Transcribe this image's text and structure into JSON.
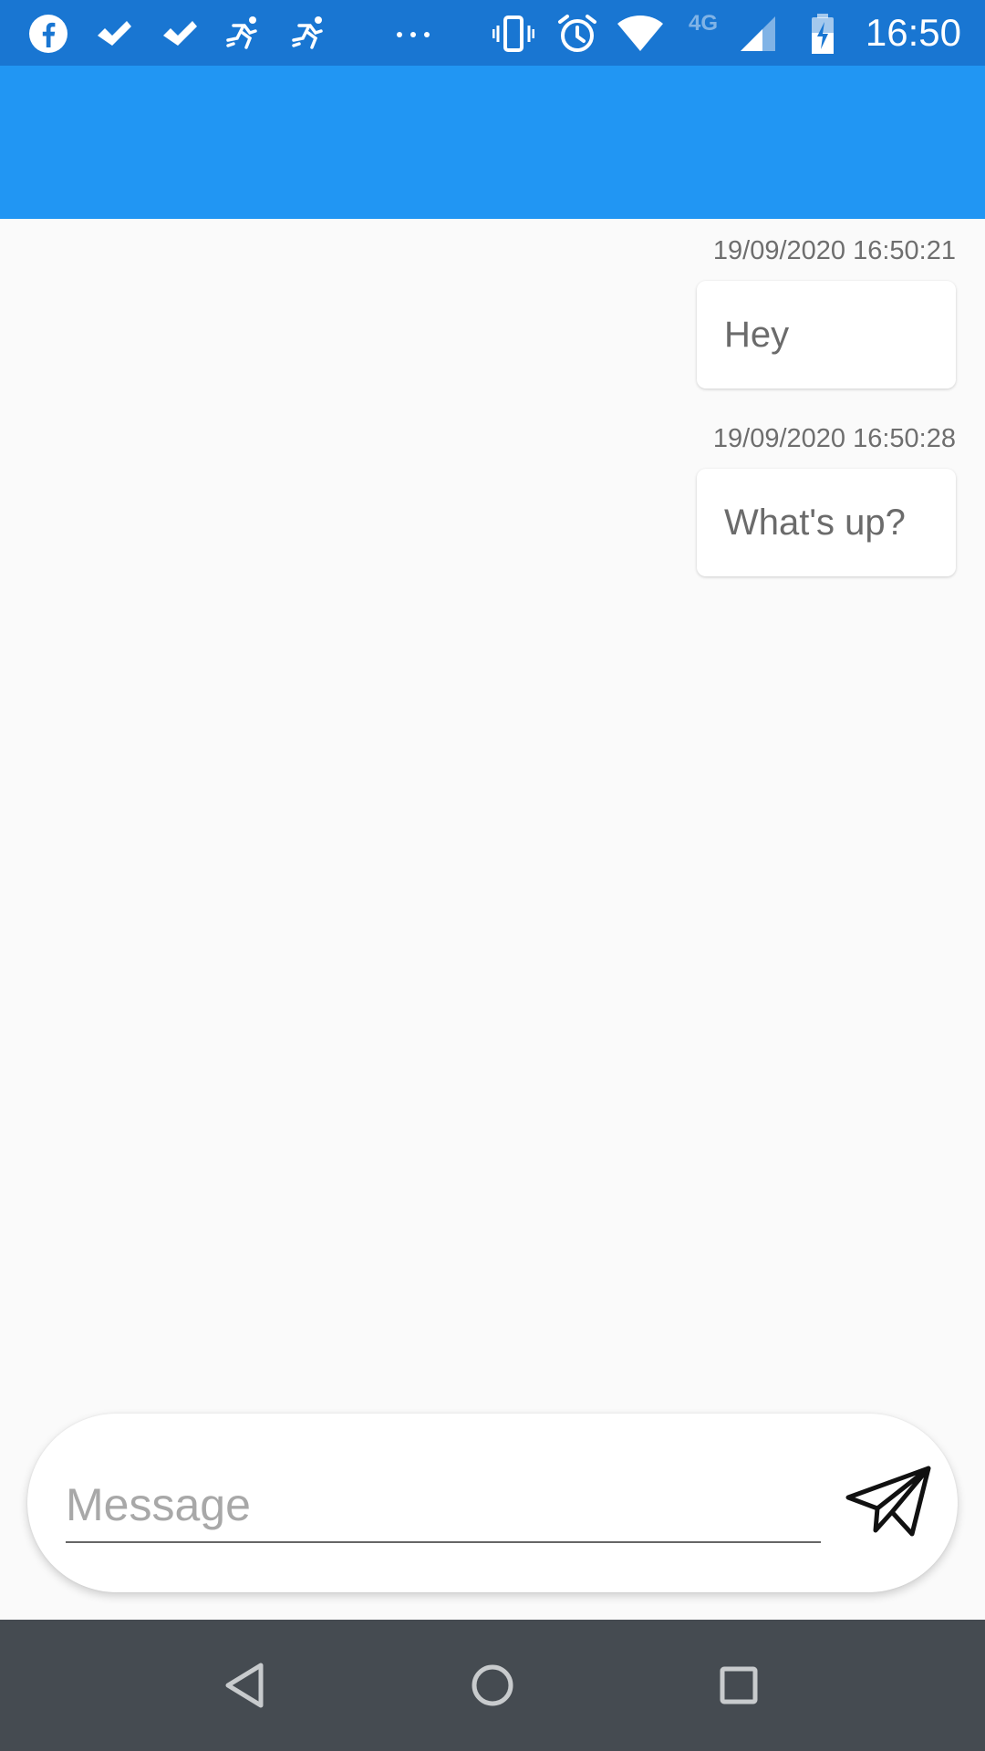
{
  "status_bar": {
    "time": "16:50",
    "network_type": "4G",
    "left_icons": [
      "facebook-icon",
      "check-icon",
      "check-icon",
      "runner-icon",
      "runner-icon",
      "more-dots-icon"
    ],
    "right_icons": [
      "vibrate-icon",
      "alarm-icon",
      "wifi-icon",
      "signal-icon",
      "battery-charging-icon"
    ]
  },
  "app_bar": {
    "title": "",
    "color": "#2196f3"
  },
  "messages": [
    {
      "timestamp": "19/09/2020 16:50:21",
      "text": "Hey"
    },
    {
      "timestamp": "19/09/2020 16:50:28",
      "text": "What's up?"
    }
  ],
  "composer": {
    "placeholder": "Message",
    "value": "",
    "send_icon": "send-icon"
  },
  "nav_bar": {
    "buttons": [
      "back-icon",
      "home-icon",
      "recents-icon"
    ]
  },
  "colors": {
    "status_bar": "#1976d2",
    "primary": "#2196f3",
    "background": "#fafafa",
    "nav_bar": "#454b51"
  }
}
